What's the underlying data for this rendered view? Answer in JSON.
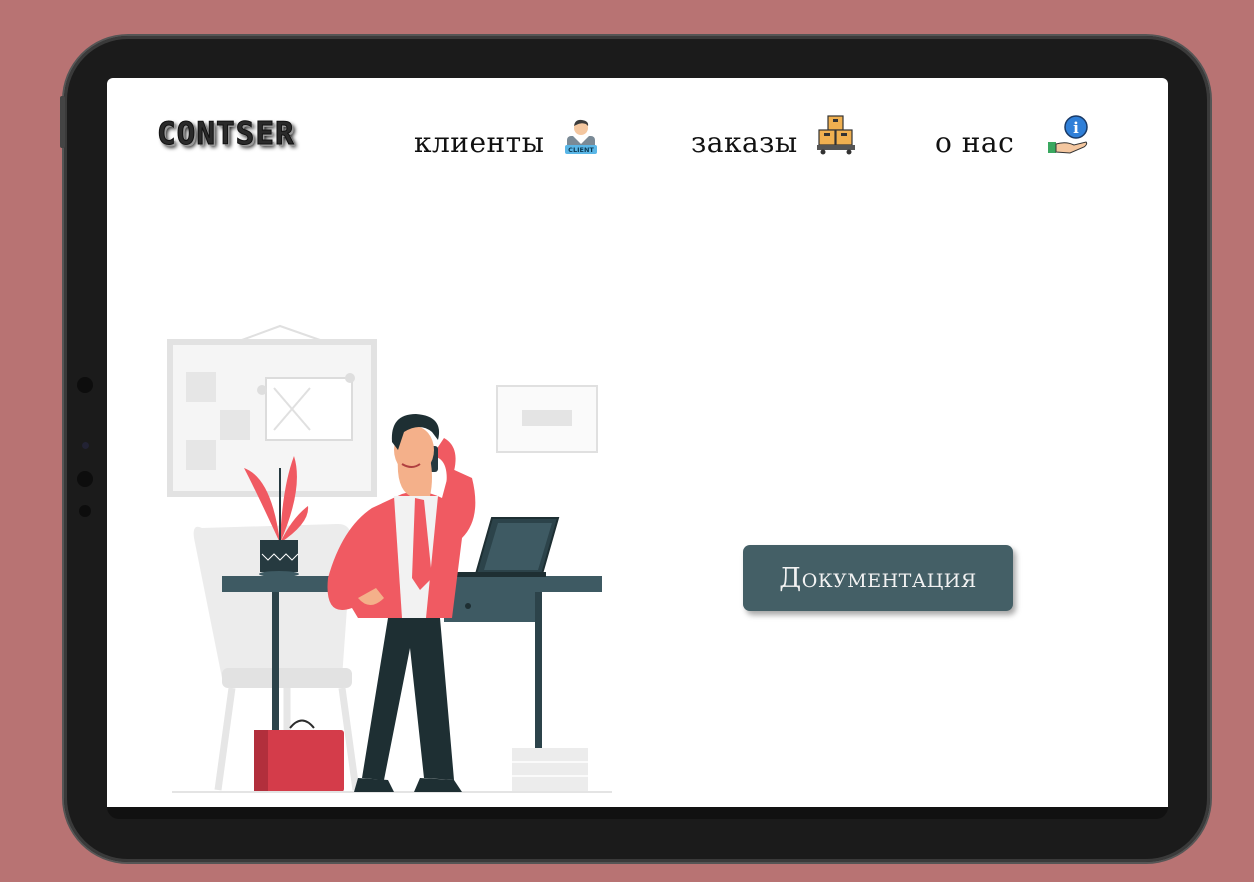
{
  "header": {
    "logo_text": "CONTSER"
  },
  "nav": {
    "items": [
      {
        "label": "клиенты",
        "icon": "client-icon"
      },
      {
        "label": "заказы",
        "icon": "boxes-icon"
      },
      {
        "label": "о нас",
        "icon": "info-hand-icon"
      }
    ]
  },
  "icons": {
    "client_badge": "CLIENT",
    "info_glyph": "i"
  },
  "main": {
    "doc_button_label": "Документация"
  },
  "colors": {
    "background": "#b87373",
    "button": "#445f66",
    "accent_red": "#f05a62",
    "desk": "#3e5a63"
  }
}
